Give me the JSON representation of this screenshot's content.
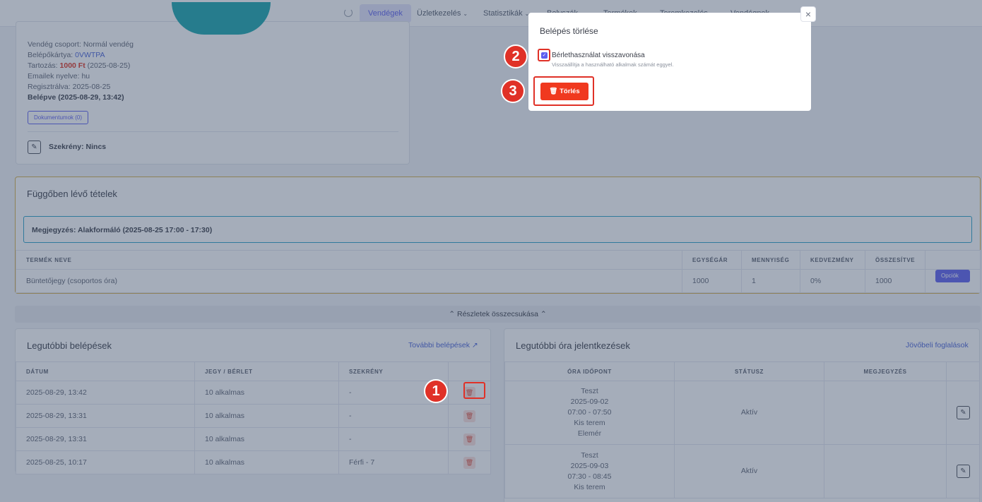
{
  "nav": {
    "items": [
      {
        "label": "Vendégek",
        "active": true,
        "caret": false
      },
      {
        "label": "Üzletkezelés",
        "active": false,
        "caret": true
      },
      {
        "label": "Statisztikák",
        "active": false,
        "caret": true
      },
      {
        "label": "Bolyszák",
        "active": false,
        "caret": false
      },
      {
        "label": "Termékek",
        "active": false,
        "caret": false
      },
      {
        "label": "Teremkezelés",
        "active": false,
        "caret": false
      },
      {
        "label": "Vendégnek",
        "active": false,
        "caret": false
      }
    ],
    "caret_glyph": "⌄"
  },
  "guest": {
    "group_label": "Vendég csoport:",
    "group_value": "Normál vendég",
    "card_label": "Belépőkártya:",
    "card_value": "0VWTPA",
    "debt_label": "Tartozás:",
    "debt_value": "1000 Ft",
    "debt_date": "(2025-08-25)",
    "email_lang_label": "Emailek nyelve:",
    "email_lang_value": "hu",
    "registered_label": "Regisztrálva:",
    "registered_value": "2025-08-25",
    "entered": "Belépve (2025-08-29, 13:42)",
    "documents_button": "Dokumentumok (0)",
    "locker": "Szekrény: Nincs"
  },
  "pending": {
    "title": "Függőben lévő tételek",
    "note": "Megjegyzés: Alakformáló (2025-08-25 17:00 - 17:30)",
    "columns": [
      "TERMÉK NEVE",
      "EGYSÉGÁR",
      "MENNYISÉG",
      "KEDVEZMÉNY",
      "ÖSSZESÍTVE",
      ""
    ],
    "rows": [
      {
        "name": "Büntetőjegy (csoportos óra)",
        "unit_price": "1000",
        "qty": "1",
        "discount": "0%",
        "total": "1000",
        "action": "Opciók"
      }
    ]
  },
  "collapse_label": "⌃ Részletek összecsukása ⌃",
  "entries": {
    "title": "Legutóbbi belépések",
    "link": "További belépések",
    "columns": [
      "DÁTUM",
      "JEGY / BÉRLET",
      "SZEKRÉNY",
      ""
    ],
    "rows": [
      {
        "date": "2025-08-29, 13:42",
        "ticket": "10 alkalmas",
        "locker": "-"
      },
      {
        "date": "2025-08-29, 13:31",
        "ticket": "10 alkalmas",
        "locker": "-"
      },
      {
        "date": "2025-08-29, 13:31",
        "ticket": "10 alkalmas",
        "locker": "-"
      },
      {
        "date": "2025-08-25, 10:17",
        "ticket": "10 alkalmas",
        "locker": "Férfi - 7"
      }
    ]
  },
  "classes": {
    "title": "Legutóbbi óra jelentkezések",
    "link": "Jövőbeli foglalások",
    "columns": [
      "ÓRA IDŐPONT",
      "STÁTUSZ",
      "MEGJEGYZÉS",
      ""
    ],
    "rows": [
      {
        "lines": [
          "Teszt",
          "2025-09-02",
          "07:00 - 07:50",
          "Kis terem",
          "Elemér"
        ],
        "status": "Aktív",
        "note": ""
      },
      {
        "lines": [
          "Teszt",
          "2025-09-03",
          "07:30 - 08:45",
          "Kis terem"
        ],
        "status": "Aktív",
        "note": ""
      }
    ]
  },
  "modal": {
    "title": "Belépés törlése",
    "checkbox_label": "Bérlethasználat visszavonása",
    "checkbox_help": "Visszaállítja a használható alkalmak számát eggyel.",
    "checkbox_checked": true,
    "delete_button": "Törlés",
    "close_glyph": "×"
  },
  "markers": [
    "1",
    "2",
    "3"
  ]
}
